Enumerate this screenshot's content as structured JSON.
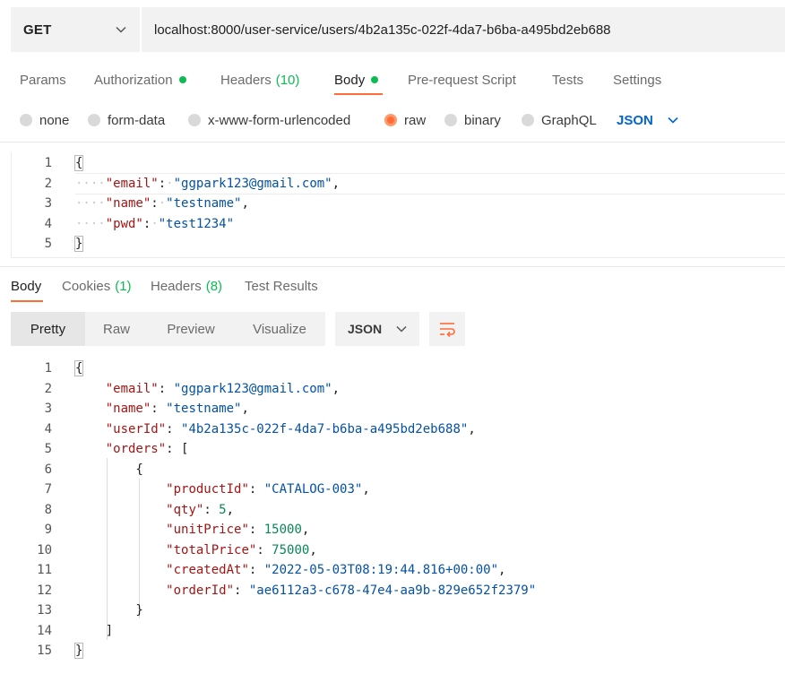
{
  "request": {
    "method": "GET",
    "url": "localhost:8000/user-service/users/4b2a135c-022f-4da7-b6ba-a495bd2eb688"
  },
  "request_tabs": [
    {
      "label": "Params"
    },
    {
      "label": "Authorization"
    },
    {
      "label": "Headers",
      "count": "(10)"
    },
    {
      "label": "Body"
    },
    {
      "label": "Pre-request Script"
    },
    {
      "label": "Tests"
    },
    {
      "label": "Settings"
    }
  ],
  "body_types": [
    "none",
    "form-data",
    "x-www-form-urlencoded",
    "raw",
    "binary",
    "GraphQL"
  ],
  "body_format": "JSON",
  "request_body": {
    "line_numbers": [
      "1",
      "2",
      "3",
      "4",
      "5"
    ],
    "lines": [
      [
        {
          "t": "p",
          "v": "{"
        }
      ],
      [
        {
          "t": "ws",
          "v": "····"
        },
        {
          "t": "k",
          "v": "\"email\""
        },
        {
          "t": "p",
          "v": ":"
        },
        {
          "t": "ws",
          "v": "·"
        },
        {
          "t": "s",
          "v": "\"ggpark123@gmail.com\""
        },
        {
          "t": "p",
          "v": ","
        }
      ],
      [
        {
          "t": "ws",
          "v": "····"
        },
        {
          "t": "k",
          "v": "\"name\""
        },
        {
          "t": "p",
          "v": ":"
        },
        {
          "t": "ws",
          "v": "·"
        },
        {
          "t": "s",
          "v": "\"testname\""
        },
        {
          "t": "p",
          "v": ","
        }
      ],
      [
        {
          "t": "ws",
          "v": "····"
        },
        {
          "t": "k",
          "v": "\"pwd\""
        },
        {
          "t": "p",
          "v": ":"
        },
        {
          "t": "ws",
          "v": "·"
        },
        {
          "t": "s",
          "v": "\"test1234\""
        }
      ],
      [
        {
          "t": "p",
          "v": "}"
        }
      ]
    ]
  },
  "response_tabs": [
    {
      "label": "Body"
    },
    {
      "label": "Cookies",
      "count": "(1)"
    },
    {
      "label": "Headers",
      "count": "(8)"
    },
    {
      "label": "Test Results"
    }
  ],
  "view_modes": [
    "Pretty",
    "Raw",
    "Preview",
    "Visualize"
  ],
  "response_format": "JSON",
  "response_body": {
    "line_numbers": [
      "1",
      "2",
      "3",
      "4",
      "5",
      "6",
      "7",
      "8",
      "9",
      "10",
      "11",
      "12",
      "13",
      "14",
      "15"
    ],
    "lines": [
      [
        {
          "t": "p",
          "v": "{"
        }
      ],
      [
        {
          "t": "p",
          "v": "    "
        },
        {
          "t": "k",
          "v": "\"email\""
        },
        {
          "t": "p",
          "v": ": "
        },
        {
          "t": "s",
          "v": "\"ggpark123@gmail.com\""
        },
        {
          "t": "p",
          "v": ","
        }
      ],
      [
        {
          "t": "p",
          "v": "    "
        },
        {
          "t": "k",
          "v": "\"name\""
        },
        {
          "t": "p",
          "v": ": "
        },
        {
          "t": "s",
          "v": "\"testname\""
        },
        {
          "t": "p",
          "v": ","
        }
      ],
      [
        {
          "t": "p",
          "v": "    "
        },
        {
          "t": "k",
          "v": "\"userId\""
        },
        {
          "t": "p",
          "v": ": "
        },
        {
          "t": "s",
          "v": "\"4b2a135c-022f-4da7-b6ba-a495bd2eb688\""
        },
        {
          "t": "p",
          "v": ","
        }
      ],
      [
        {
          "t": "p",
          "v": "    "
        },
        {
          "t": "k",
          "v": "\"orders\""
        },
        {
          "t": "p",
          "v": ": ["
        }
      ],
      [
        {
          "t": "p",
          "v": "        {"
        }
      ],
      [
        {
          "t": "p",
          "v": "            "
        },
        {
          "t": "k",
          "v": "\"productId\""
        },
        {
          "t": "p",
          "v": ": "
        },
        {
          "t": "s",
          "v": "\"CATALOG-003\""
        },
        {
          "t": "p",
          "v": ","
        }
      ],
      [
        {
          "t": "p",
          "v": "            "
        },
        {
          "t": "k",
          "v": "\"qty\""
        },
        {
          "t": "p",
          "v": ": "
        },
        {
          "t": "n",
          "v": "5"
        },
        {
          "t": "p",
          "v": ","
        }
      ],
      [
        {
          "t": "p",
          "v": "            "
        },
        {
          "t": "k",
          "v": "\"unitPrice\""
        },
        {
          "t": "p",
          "v": ": "
        },
        {
          "t": "n",
          "v": "15000"
        },
        {
          "t": "p",
          "v": ","
        }
      ],
      [
        {
          "t": "p",
          "v": "            "
        },
        {
          "t": "k",
          "v": "\"totalPrice\""
        },
        {
          "t": "p",
          "v": ": "
        },
        {
          "t": "n",
          "v": "75000"
        },
        {
          "t": "p",
          "v": ","
        }
      ],
      [
        {
          "t": "p",
          "v": "            "
        },
        {
          "t": "k",
          "v": "\"createdAt\""
        },
        {
          "t": "p",
          "v": ": "
        },
        {
          "t": "s",
          "v": "\"2022-05-03T08:19:44.816+00:00\""
        },
        {
          "t": "p",
          "v": ","
        }
      ],
      [
        {
          "t": "p",
          "v": "            "
        },
        {
          "t": "k",
          "v": "\"orderId\""
        },
        {
          "t": "p",
          "v": ": "
        },
        {
          "t": "s",
          "v": "\"ae6112a3-c678-47e4-aa9b-829e652f2379\""
        }
      ],
      [
        {
          "t": "p",
          "v": "        }"
        }
      ],
      [
        {
          "t": "p",
          "v": "    ]"
        }
      ],
      [
        {
          "t": "p",
          "v": "}"
        }
      ]
    ]
  },
  "icons": {
    "method_dropdown": "chevron-down-icon",
    "format_dropdown": "chevron-down-icon",
    "wrap": "wrap-lines-icon"
  },
  "colors": {
    "accent": "#ff6c37",
    "status_green": "#0cbb52",
    "link_blue": "#0265d2",
    "json_key": "#a31515",
    "json_string": "#0451a5",
    "json_number": "#098658"
  }
}
